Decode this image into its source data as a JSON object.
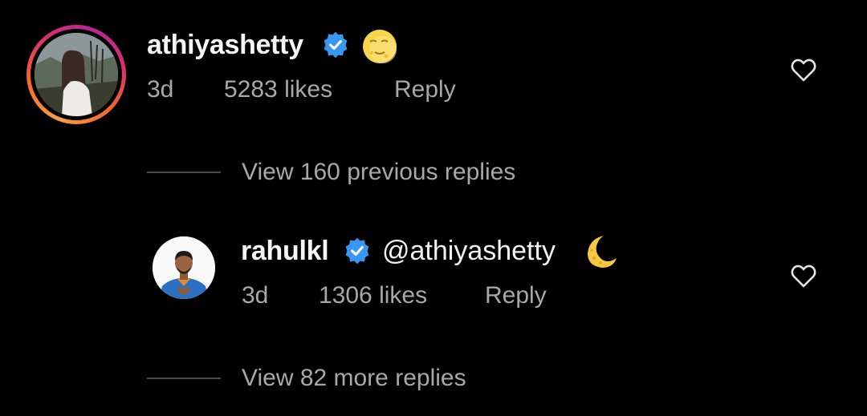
{
  "comments": [
    {
      "username": "athiyashetty",
      "verified": true,
      "text": "",
      "emoji": "moon-face-emoji",
      "time": "3d",
      "likes": "5283 likes",
      "reply": "Reply",
      "view_replies": "View 160 previous replies"
    },
    {
      "username": "rahulkl",
      "verified": true,
      "text": "@athiyashetty",
      "emoji": "crescent-moon-emoji",
      "time": "3d",
      "likes": "1306 likes",
      "reply": "Reply",
      "view_replies": "View 82 more replies"
    }
  ],
  "colors": {
    "background": "#000000",
    "primary_text": "#f5f5f5",
    "secondary_text": "#a8a8a8",
    "verified_blue": "#3897f0",
    "ring_start": "#f9a23a",
    "ring_end": "#b3279a"
  },
  "icons": {
    "like": "heart-outline-icon",
    "verified": "verified-badge-icon"
  }
}
